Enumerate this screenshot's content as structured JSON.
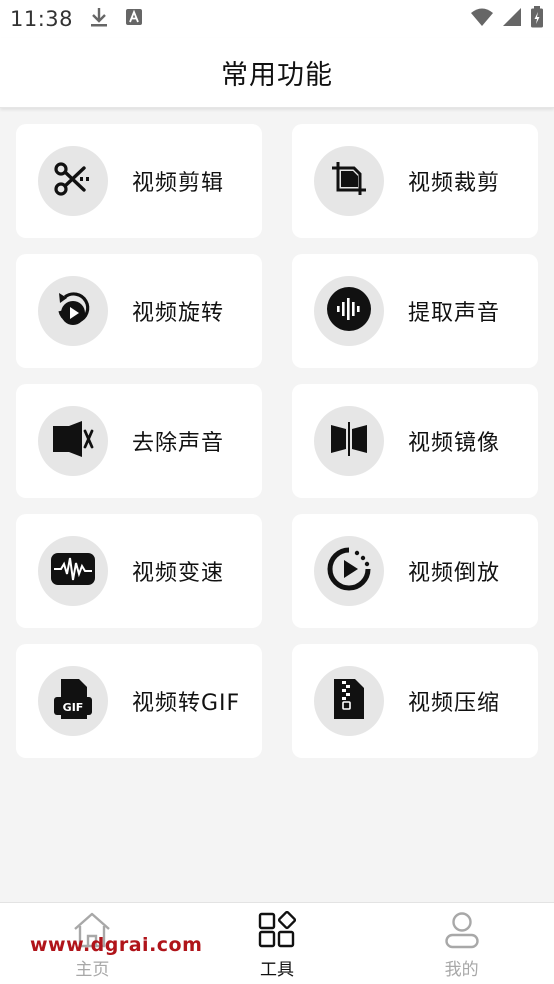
{
  "status_bar": {
    "time": "11:38",
    "left_icons": [
      "download-icon",
      "font-app-icon"
    ],
    "right_icons": [
      "wifi-icon",
      "signal-icon",
      "battery-icon"
    ]
  },
  "header": {
    "title": "常用功能"
  },
  "tools": [
    {
      "label": "视频剪辑",
      "icon": "scissors-icon"
    },
    {
      "label": "视频裁剪",
      "icon": "crop-icon"
    },
    {
      "label": "视频旋转",
      "icon": "rotate-icon"
    },
    {
      "label": "提取声音",
      "icon": "audio-wave-icon"
    },
    {
      "label": "去除声音",
      "icon": "mute-icon"
    },
    {
      "label": "视频镜像",
      "icon": "mirror-icon"
    },
    {
      "label": "视频变速",
      "icon": "speed-icon"
    },
    {
      "label": "视频倒放",
      "icon": "reverse-icon"
    },
    {
      "label": "视频转GIF",
      "icon": "gif-file-icon"
    },
    {
      "label": "视频压缩",
      "icon": "zip-file-icon"
    }
  ],
  "bottom_nav": {
    "home": {
      "label": "主页",
      "icon": "home-icon",
      "active": false
    },
    "tools": {
      "label": "工具",
      "icon": "grid-icon",
      "active": true
    },
    "mine": {
      "label": "我的",
      "icon": "user-icon",
      "active": false
    }
  },
  "watermark": "www.dgrai.com",
  "colors": {
    "background": "#f4f4f4",
    "card": "#ffffff",
    "icon_circle": "#e6e6e6",
    "active_text": "#111111",
    "inactive_text": "#a8a8a8",
    "watermark": "#b0141a"
  }
}
